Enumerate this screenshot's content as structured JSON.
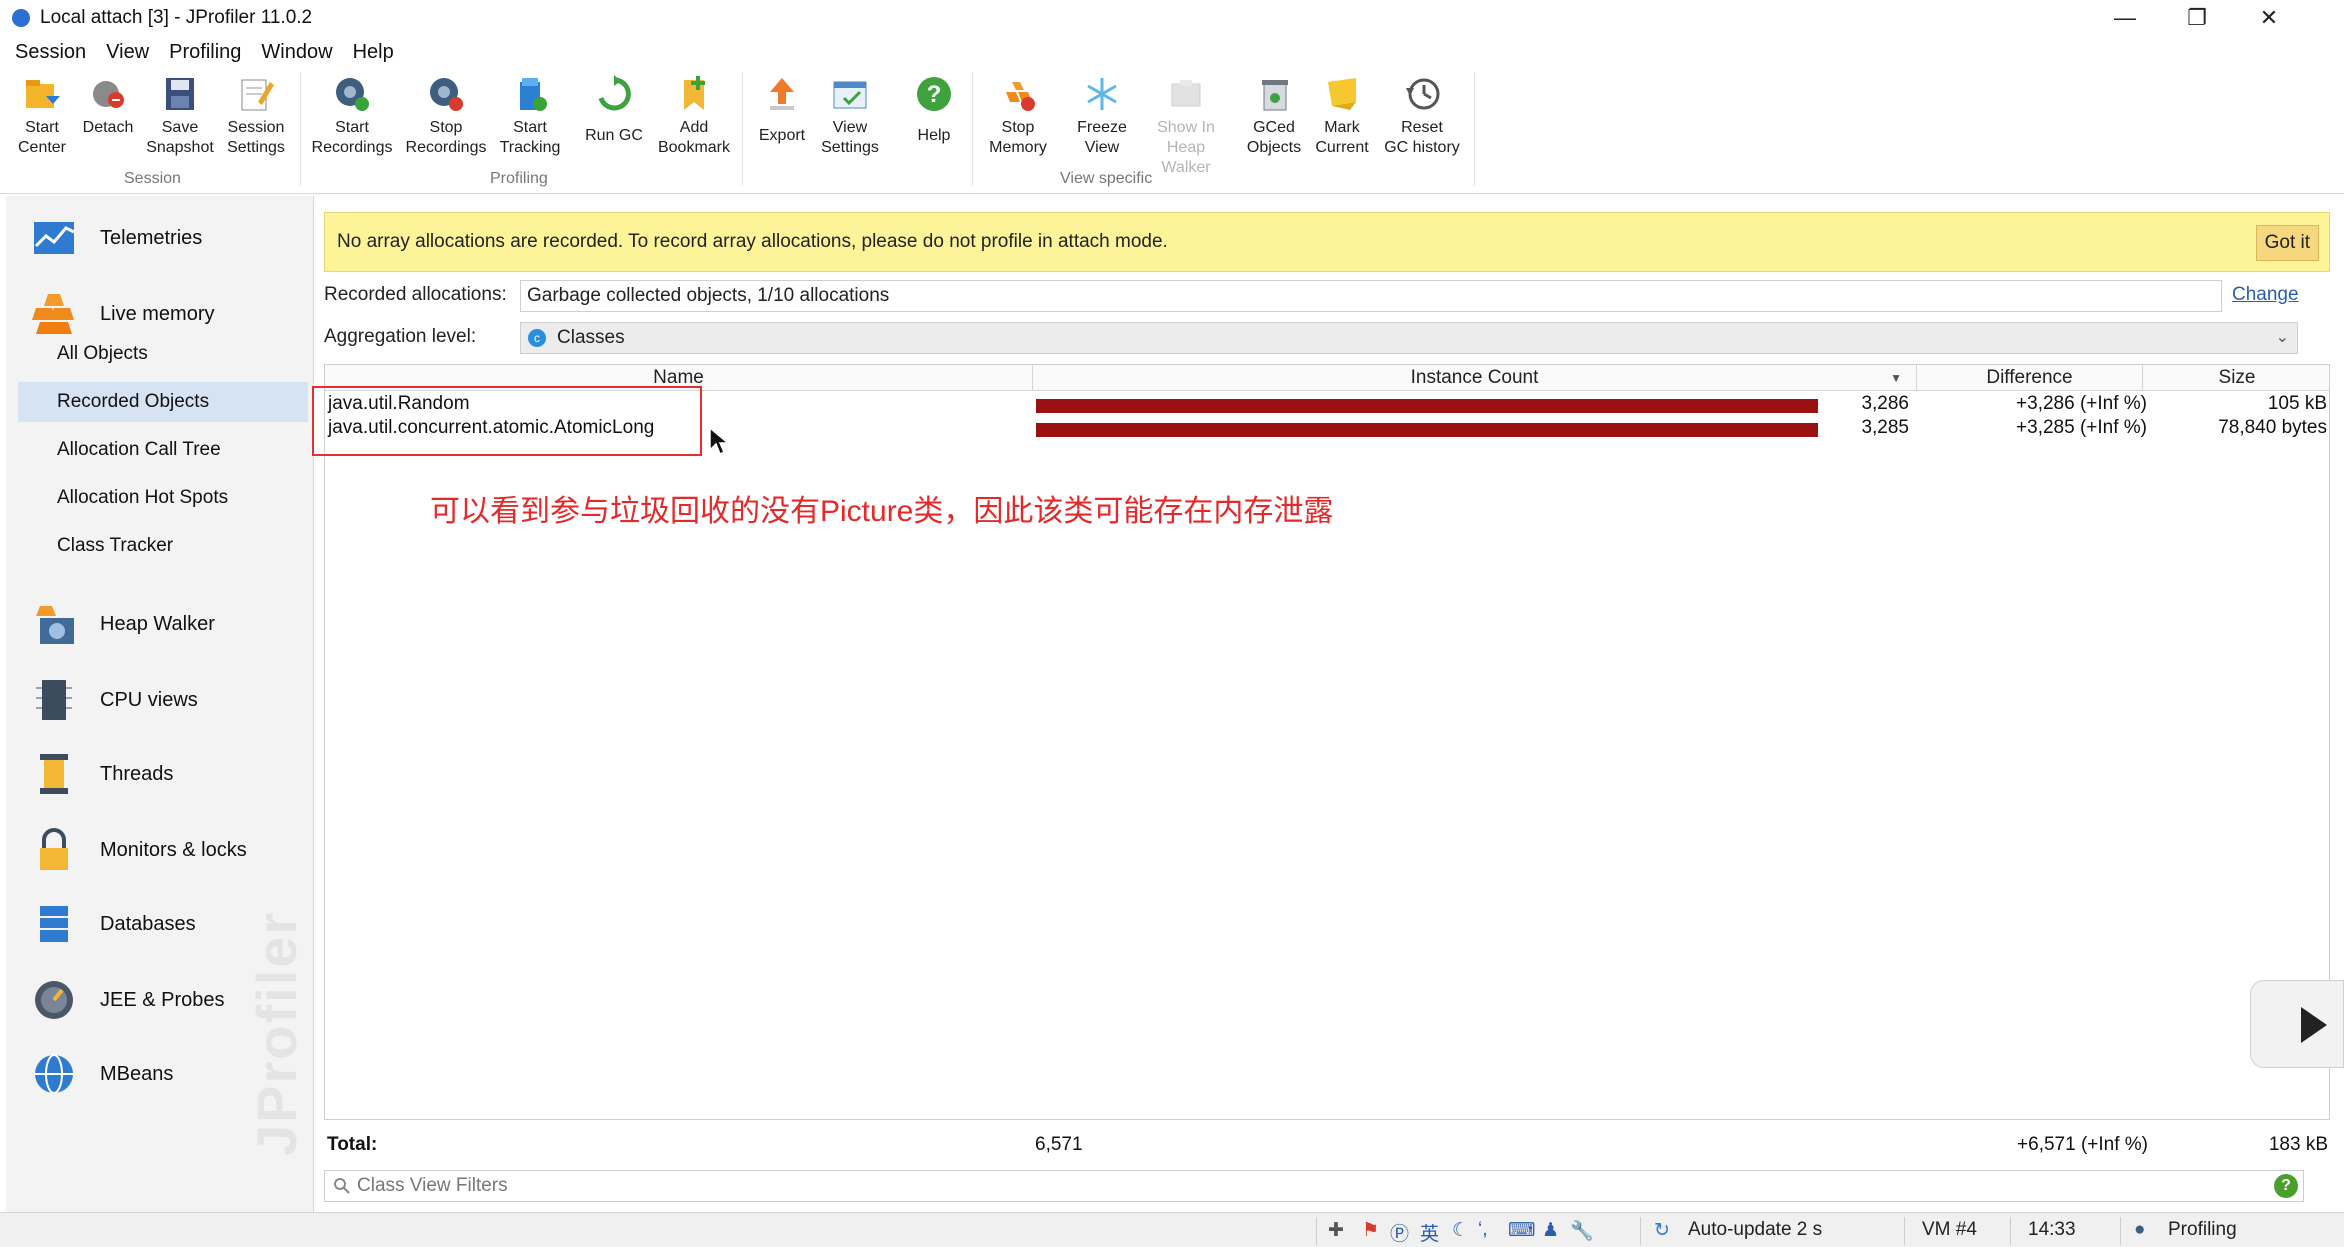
{
  "window": {
    "title": "Local attach [3] - JProfiler 11.0.2",
    "controls": [
      "minimize",
      "restore",
      "close"
    ]
  },
  "menu": [
    "Session",
    "View",
    "Profiling",
    "Window",
    "Help"
  ],
  "toolbar": {
    "buttons": [
      {
        "label": "Start\nCenter",
        "icon": "start-center-icon"
      },
      {
        "label": "Detach",
        "icon": "detach-icon"
      },
      {
        "label": "Save\nSnapshot",
        "icon": "save-snapshot-icon"
      },
      {
        "label": "Session\nSettings",
        "icon": "session-settings-icon"
      },
      {
        "label": "Start\nRecordings",
        "icon": "start-recordings-icon"
      },
      {
        "label": "Stop\nRecordings",
        "icon": "stop-recordings-icon"
      },
      {
        "label": "Start\nTracking",
        "icon": "start-tracking-icon"
      },
      {
        "label": "Run GC",
        "icon": "run-gc-icon"
      },
      {
        "label": "Add\nBookmark",
        "icon": "add-bookmark-icon"
      },
      {
        "label": "Export",
        "icon": "export-icon"
      },
      {
        "label": "View\nSettings",
        "icon": "view-settings-icon"
      },
      {
        "label": "Help",
        "icon": "help-icon"
      },
      {
        "label": "Stop\nMemory",
        "icon": "stop-memory-icon"
      },
      {
        "label": "Freeze\nView",
        "icon": "freeze-view-icon"
      },
      {
        "label": "Show In\nHeap Walker",
        "icon": "show-in-heap-walker-icon",
        "disabled": true
      },
      {
        "label": "GCed\nObjects",
        "icon": "gced-objects-icon"
      },
      {
        "label": "Mark\nCurrent",
        "icon": "mark-current-icon"
      },
      {
        "label": "Reset\nGC history",
        "icon": "reset-gc-history-icon"
      }
    ],
    "groups": {
      "session": "Session",
      "profiling": "Profiling",
      "view_specific": "View specific"
    }
  },
  "sidebar": {
    "sections": [
      {
        "label": "Telemetries",
        "icon": "telemetries-icon"
      },
      {
        "label": "Live memory",
        "icon": "live-memory-icon"
      },
      {
        "label": "Heap Walker",
        "icon": "heap-walker-icon"
      },
      {
        "label": "CPU views",
        "icon": "cpu-views-icon"
      },
      {
        "label": "Threads",
        "icon": "threads-icon"
      },
      {
        "label": "Monitors & locks",
        "icon": "monitors-locks-icon"
      },
      {
        "label": "Databases",
        "icon": "databases-icon"
      },
      {
        "label": "JEE & Probes",
        "icon": "jee-probes-icon"
      },
      {
        "label": "MBeans",
        "icon": "mbeans-icon"
      }
    ],
    "subitems": [
      "All Objects",
      "Recorded Objects",
      "Allocation Call Tree",
      "Allocation Hot Spots",
      "Class Tracker"
    ],
    "selected_subitem": "Recorded Objects",
    "watermark": "JProfiler"
  },
  "banner": {
    "text": "No array allocations are recorded. To record array allocations, please do not profile in attach mode.",
    "button": "Got it"
  },
  "recorded": {
    "label": "Recorded allocations:",
    "value": "Garbage collected objects, 1/10 allocations",
    "change": "Change"
  },
  "aggregation": {
    "label": "Aggregation level:",
    "value": "Classes"
  },
  "table": {
    "headers": {
      "name": "Name",
      "count": "Instance Count",
      "diff": "Difference",
      "size": "Size"
    },
    "rows": [
      {
        "name": "java.util.Random",
        "count": "3,286",
        "count_value": 3286,
        "diff": "+3,286 (+Inf %)",
        "size": "105 kB"
      },
      {
        "name": "java.util.concurrent.atomic.AtomicLong",
        "count": "3,285",
        "count_value": 3285,
        "diff": "+3,285 (+Inf %)",
        "size": "78,840 bytes"
      }
    ],
    "max_count": 3286,
    "total": {
      "label": "Total:",
      "count": "6,571",
      "diff": "+6,571 (+Inf %)",
      "size": "183 kB"
    }
  },
  "annotation": "可以看到参与垃圾回收的没有Picture类，因此该类可能存在内存泄露",
  "filter": {
    "placeholder": "Class View Filters"
  },
  "status": {
    "ime": "英",
    "auto_update": "Auto-update 2 s",
    "vm": "VM #4",
    "time": "14:33",
    "mode": "Profiling"
  }
}
